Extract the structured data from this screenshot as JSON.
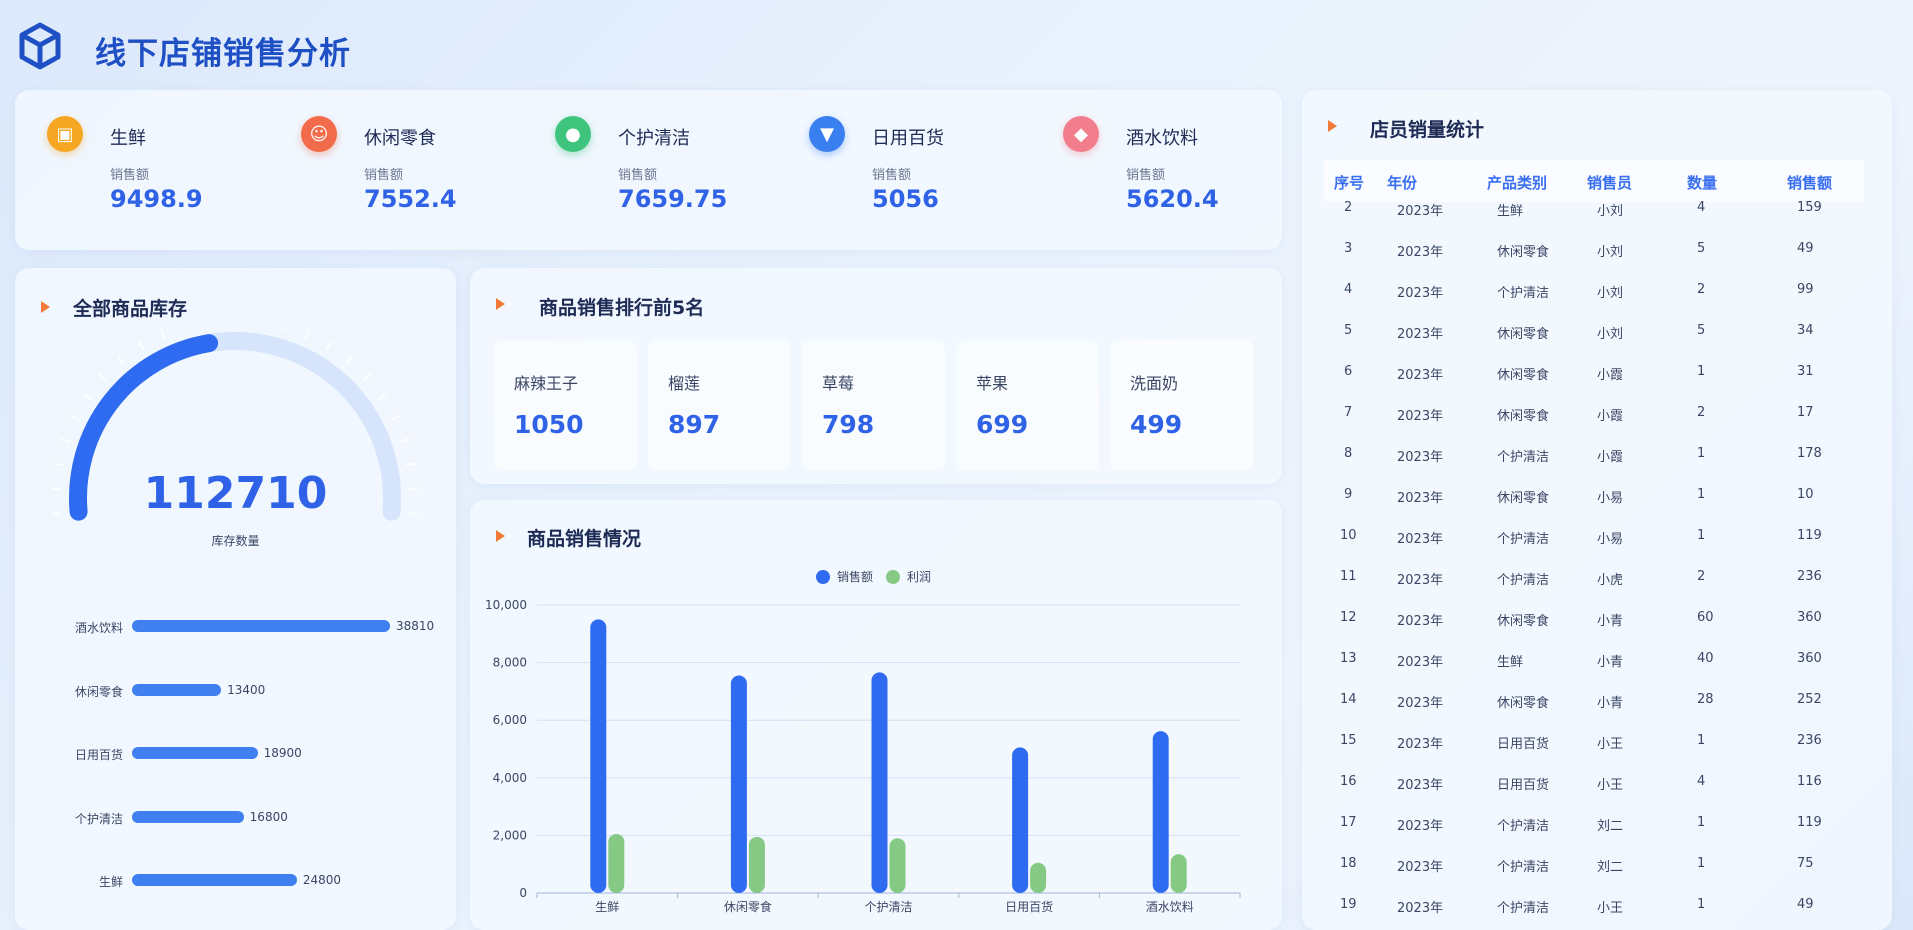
{
  "header": {
    "title": "线下店铺销售分析"
  },
  "kpis": [
    {
      "name": "生鲜",
      "sub_label": "销售额",
      "value": "9498.9",
      "color": "#f5a623",
      "icon": "gift-icon"
    },
    {
      "name": "休闲零食",
      "sub_label": "销售额",
      "value": "7552.4",
      "color": "#f26b4a",
      "icon": "smile-icon"
    },
    {
      "name": "个护清洁",
      "sub_label": "销售额",
      "value": "7659.75",
      "color": "#3fc47d",
      "icon": "bulb-icon"
    },
    {
      "name": "日用百货",
      "sub_label": "销售额",
      "value": "5056",
      "color": "#3a7ff0",
      "icon": "diamond-icon"
    },
    {
      "name": "酒水饮料",
      "sub_label": "销售额",
      "value": "5620.4",
      "color": "#f27d8d",
      "icon": "tag-icon"
    }
  ],
  "inventory": {
    "title": "全部商品库存",
    "total": "112710",
    "total_label": "库存数量",
    "gauge_fraction": 0.45,
    "items": [
      {
        "label": "酒水饮料",
        "value": 38810
      },
      {
        "label": "休闲零食",
        "value": 13400
      },
      {
        "label": "日用百货",
        "value": 18900
      },
      {
        "label": "个护清洁",
        "value": 16800
      },
      {
        "label": "生鲜",
        "value": 24800
      }
    ]
  },
  "top5": {
    "title": "商品销售排行前5名",
    "items": [
      {
        "name": "麻辣王子",
        "value": "1050"
      },
      {
        "name": "榴莲",
        "value": "897"
      },
      {
        "name": "草莓",
        "value": "798"
      },
      {
        "name": "苹果",
        "value": "699"
      },
      {
        "name": "洗面奶",
        "value": "499"
      }
    ]
  },
  "sales_chart": {
    "title": "商品销售情况"
  },
  "chart_data": {
    "type": "bar",
    "categories": [
      "生鲜",
      "休闲零食",
      "个护清洁",
      "日用百货",
      "酒水饮料"
    ],
    "series": [
      {
        "name": "销售额",
        "values": [
          9498.9,
          7552.4,
          7659.75,
          5056,
          5620.4
        ],
        "color": "#2f6bf0"
      },
      {
        "name": "利润",
        "values": [
          2050,
          1950,
          1900,
          1050,
          1350
        ],
        "color": "#86c984"
      }
    ],
    "ylim": [
      0,
      10000
    ],
    "yticks": [
      "0",
      "2,000",
      "4,000",
      "6,000",
      "8,000",
      "10,000"
    ],
    "legend": "top-center",
    "grid": true
  },
  "staff_table": {
    "title": "店员销量统计",
    "headers": [
      "序号",
      "年份",
      "产品类别",
      "销售员",
      "数量",
      "销售额"
    ],
    "rows": [
      [
        "2",
        "2023年",
        "生鲜",
        "小刘",
        "4",
        "159"
      ],
      [
        "3",
        "2023年",
        "休闲零食",
        "小刘",
        "5",
        "49"
      ],
      [
        "4",
        "2023年",
        "个护清洁",
        "小刘",
        "2",
        "99"
      ],
      [
        "5",
        "2023年",
        "休闲零食",
        "小刘",
        "5",
        "34"
      ],
      [
        "6",
        "2023年",
        "休闲零食",
        "小霞",
        "1",
        "31"
      ],
      [
        "7",
        "2023年",
        "休闲零食",
        "小霞",
        "2",
        "17"
      ],
      [
        "8",
        "2023年",
        "个护清洁",
        "小霞",
        "1",
        "178"
      ],
      [
        "9",
        "2023年",
        "休闲零食",
        "小易",
        "1",
        "10"
      ],
      [
        "10",
        "2023年",
        "个护清洁",
        "小易",
        "1",
        "119"
      ],
      [
        "11",
        "2023年",
        "个护清洁",
        "小虎",
        "2",
        "236"
      ],
      [
        "12",
        "2023年",
        "休闲零食",
        "小青",
        "60",
        "360"
      ],
      [
        "13",
        "2023年",
        "生鲜",
        "小青",
        "40",
        "360"
      ],
      [
        "14",
        "2023年",
        "休闲零食",
        "小青",
        "28",
        "252"
      ],
      [
        "15",
        "2023年",
        "日用百货",
        "小王",
        "1",
        "236"
      ],
      [
        "16",
        "2023年",
        "日用百货",
        "小王",
        "4",
        "116"
      ],
      [
        "17",
        "2023年",
        "个护清洁",
        "刘二",
        "1",
        "119"
      ],
      [
        "18",
        "2023年",
        "个护清洁",
        "刘二",
        "1",
        "75"
      ],
      [
        "19",
        "2023年",
        "个护清洁",
        "小王",
        "1",
        "49"
      ]
    ]
  }
}
